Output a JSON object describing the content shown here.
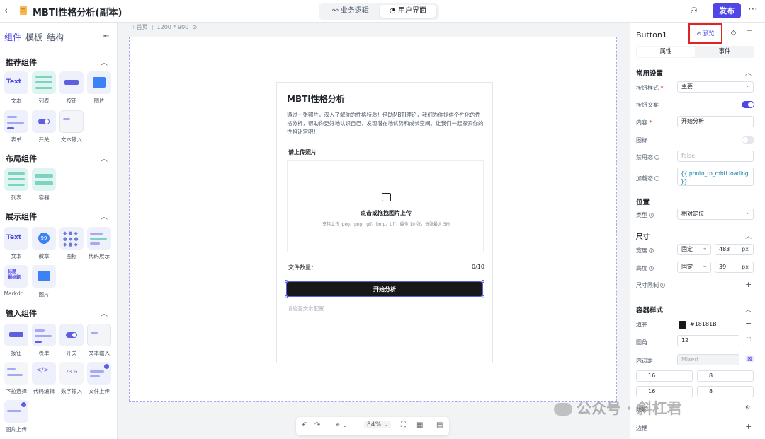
{
  "topbar": {
    "title": "MBTI性格分析(副本)",
    "tabs": [
      "业务逻辑",
      "用户界面"
    ],
    "active_tab": "用户界面",
    "publish_label": "发布"
  },
  "left": {
    "tabs": [
      "组件",
      "模板",
      "结构"
    ],
    "sections": [
      {
        "title": "推荐组件",
        "items": [
          "文本",
          "列表",
          "按钮",
          "图片",
          "表单",
          "开关",
          "文本输入"
        ]
      },
      {
        "title": "布局组件",
        "items": [
          "列表",
          "容器"
        ]
      },
      {
        "title": "展示组件",
        "items": [
          "文本",
          "徽章",
          "图标",
          "代码展示",
          "Markdo...",
          "图片"
        ]
      },
      {
        "title": "输入组件",
        "items": [
          "按钮",
          "表单",
          "开关",
          "文本输入",
          "下拉选择",
          "代码编辑",
          "数字输入",
          "文件上传",
          "图片上传"
        ]
      }
    ],
    "icon_texts": {
      "text": "Text",
      "badge": "99",
      "markdown": "标题\n副标题"
    }
  },
  "canvas": {
    "breadcrumb_page": "首页",
    "breadcrumb_size": "1200 * 900",
    "card": {
      "title": "MBTI性格分析",
      "description": "通过一张照片，深入了解你的性格特质！借助MBTI理论，我们为你提供个性化的性格分析，帮助你更好地认识自己，发现潜在地优势和成长空间。让我们一起探索你的性格迷宫吧！",
      "upload_label": "请上传照片",
      "upload_main": "点击或拖拽图片上传",
      "upload_hint": "支持上传 jpeg、png、gif、bmp、tiff，最多 10 张，每张最大 5M",
      "file_count_label": "文件数量：",
      "file_count": "0/10",
      "button_label": "开始分析",
      "hint_text": "请检查文本配置"
    },
    "zoom": "84%"
  },
  "right": {
    "component_name": "Button1",
    "preview_label": "预览",
    "tabs": [
      "属性",
      "事件"
    ],
    "active_tab": "属性",
    "common": {
      "title": "常用设置",
      "style_label": "按钮样式",
      "style_value": "主要",
      "text_label": "按钮文案",
      "content_label": "内容",
      "content_value": "开始分析",
      "icon_label": "图标",
      "disabled_label": "禁用态",
      "disabled_value": "false",
      "loading_label": "加载态",
      "loading_value": "{{ photo_to_mbti.loading }}"
    },
    "position": {
      "title": "位置",
      "type_label": "类型",
      "type_value": "相对定位"
    },
    "size": {
      "title": "尺寸",
      "width_label": "宽度",
      "width_mode": "固定",
      "width_value": "483",
      "height_label": "高度",
      "height_mode": "固定",
      "height_value": "39",
      "unit": "px",
      "limit_label": "尺寸限制"
    },
    "container": {
      "title": "容器样式",
      "fill_label": "填充",
      "fill_value": "#18181B",
      "radius_label": "圆角",
      "radius_value": "12",
      "padding_label": "内边距",
      "padding_mode": "Mixed",
      "paddings": [
        "16",
        "8",
        "16",
        "8"
      ],
      "shadow_label": "阴影",
      "border_label": "边框"
    }
  },
  "watermark": "公众号 · 斜杠君",
  "colors": {
    "accent": "#4f46e5",
    "button_fill": "#18181B",
    "highlight": "#e02424"
  }
}
